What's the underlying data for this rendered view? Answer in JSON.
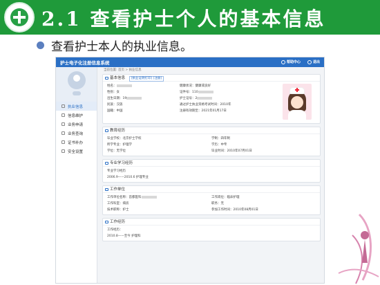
{
  "slide": {
    "title": "2.1 查看护士个人的基本信息",
    "bullet": "查看护士本人的执业信息。"
  },
  "system": {
    "app_title": "护士电子化注册信息系统",
    "header_links": [
      "帮助中心",
      "退出"
    ],
    "breadcrumb": "当前位置: 首页 > 执业信息",
    "sidebar": {
      "items": [
        {
          "label": "执业信息",
          "active": true
        },
        {
          "label": "信息维护",
          "active": false
        },
        {
          "label": "业务申请",
          "active": false
        },
        {
          "label": "业务查询",
          "active": false
        },
        {
          "label": "证书补办",
          "active": false
        },
        {
          "label": "安全设置",
          "active": false
        }
      ]
    },
    "basic": {
      "title": "基本信息",
      "tag": "[执业证明打印] [注册]",
      "left": [
        "姓名：",
        "性别：女",
        "出生日期：19",
        "民族：汉族",
        "国籍：中国"
      ],
      "right": [
        "健康状况：健康或良好",
        "证件号：110",
        "护士证号：2",
        "通过护士执业资格考试时间：2010年",
        "注册有效期至：2021年01月17日"
      ]
    },
    "education": {
      "title": "教育经历",
      "rows": [
        [
          "毕业学校：北京护士学校",
          "学制：四年制"
        ],
        [
          "所学专业：护理学",
          "学历：中专"
        ],
        [
          "学位：无学位",
          "毕业时间：2010年07月01日"
        ]
      ]
    },
    "study": {
      "title": "专业学习经历",
      "rows": [
        "专业学习经历",
        "2006.9——2010.6  护理专业"
      ]
    },
    "unit": {
      "title": "工作单位",
      "rows": [
        [
          "工作单位名称：首都医科",
          "工作岗位：临床护理"
        ],
        [
          "工作科室：病房",
          "职务：无"
        ],
        [
          "技术职称：护士",
          "参加工作时间：2010年08月01日"
        ]
      ]
    },
    "work": {
      "title": "工作经历",
      "rows": [
        "工作经历：",
        "2010.8——至今  护理科"
      ]
    }
  },
  "colors": {
    "header_green": "#1f9a3a",
    "system_blue": "#2a6fc5"
  }
}
